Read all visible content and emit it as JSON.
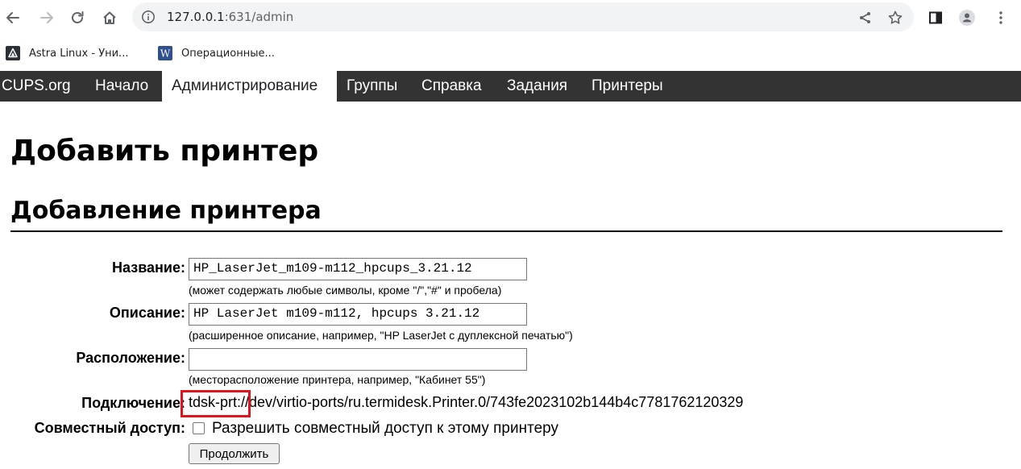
{
  "browser": {
    "url_host": "127.0.0.1",
    "url_rest": ":631/admin",
    "icons": [
      "back-icon",
      "forward-icon",
      "reload-icon",
      "home-icon",
      "info-icon",
      "share-icon",
      "star-icon",
      "sidepanel-icon",
      "profile-icon",
      "menu-icon"
    ]
  },
  "bookmarks": [
    {
      "label": "Astra Linux - Уни...",
      "icon": "astra-logo-icon"
    },
    {
      "label": "Операционные...",
      "icon": "wikipedia-icon"
    }
  ],
  "nav": {
    "items": [
      "CUPS.org",
      "Начало",
      "Администрирование",
      "Группы",
      "Справка",
      "Задания",
      "Принтеры"
    ],
    "active": "Администрирование"
  },
  "page": {
    "title": "Добавить принтер",
    "subtitle": "Добавление принтера"
  },
  "form": {
    "name_label": "Название:",
    "name_value": "HP_LaserJet_m109-m112_hpcups_3.21.12",
    "name_hint": "(может содержать любые символы, кроме \"/\",\"#\" и пробела)",
    "desc_label": "Описание:",
    "desc_value": "HP LaserJet m109-m112, hpcups 3.21.12",
    "desc_hint": "(расширенное описание, например, \"HP LaserJet с дуплексной печатью\")",
    "location_label": "Расположение:",
    "location_value": "",
    "location_hint": "(месторасположение принтера, например, \"Кабинет 55\")",
    "connection_label": "Подключение:",
    "connection_value": "tdsk-prt://dev/virtio-ports/ru.termidesk.Printer.0/743fe2023102b144b4c7781762120329",
    "share_label": "Совместный доступ:",
    "share_checkbox_label": "Разрешить совместный доступ к этому принтеру",
    "share_checked": false,
    "continue_button": "Продолжить"
  },
  "colors": {
    "nav_bg": "#333333",
    "highlight_box": "#e0141e"
  }
}
